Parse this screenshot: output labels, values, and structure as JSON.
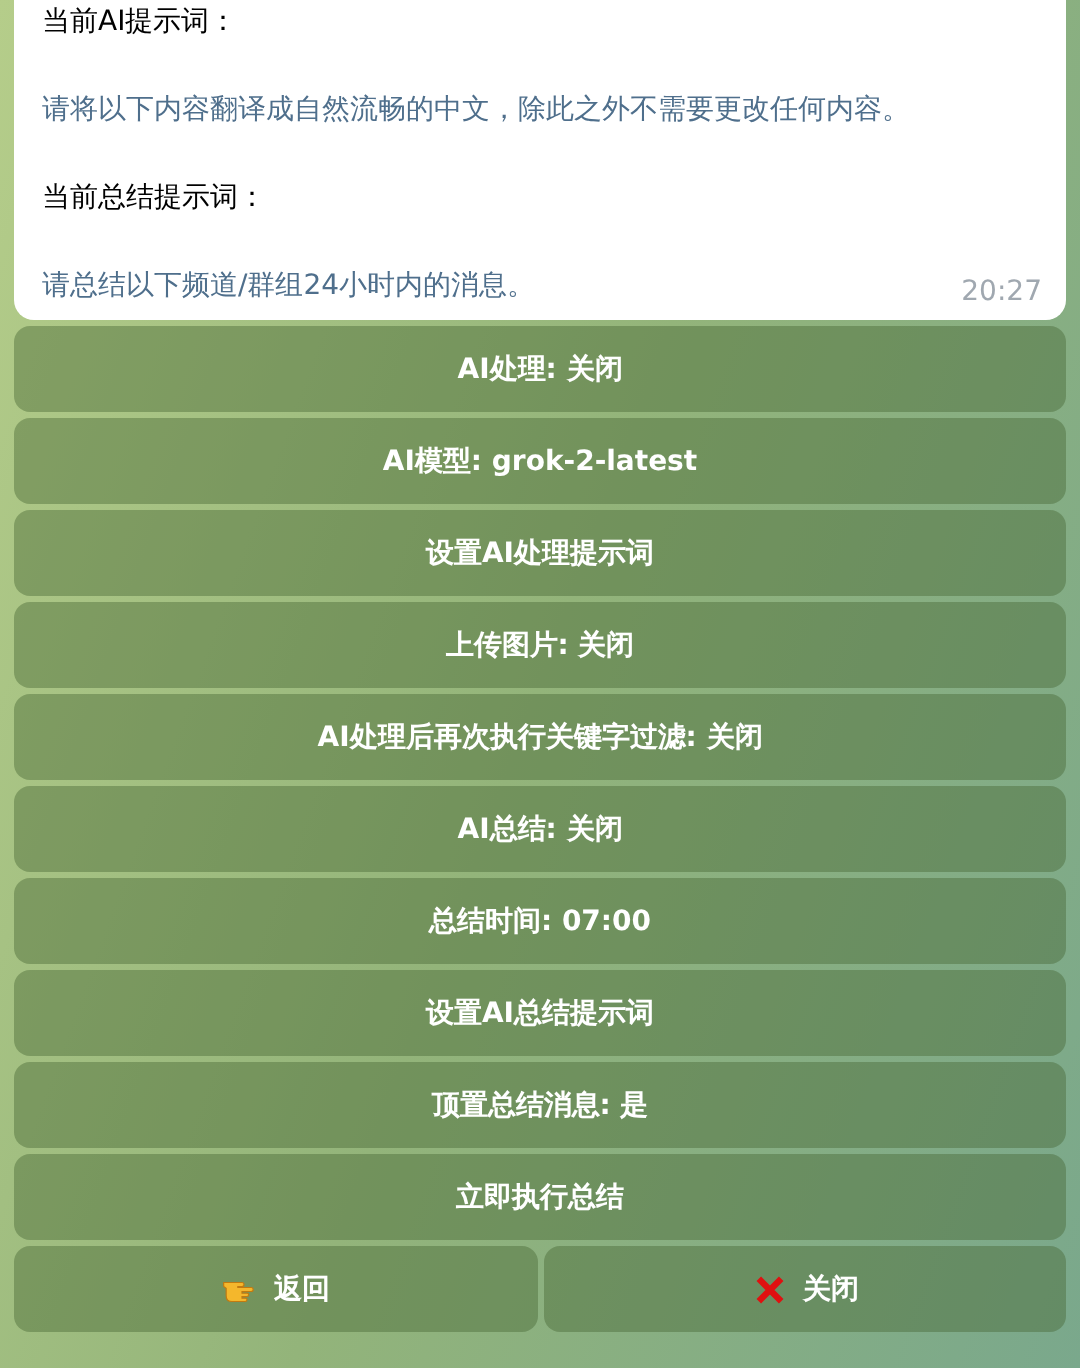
{
  "message": {
    "lines": [
      {
        "kind": "label",
        "text": "当前AI提示词："
      },
      {
        "kind": "value",
        "text": "请将以下内容翻译成自然流畅的中文，除此之外不需要更改任何内容。"
      },
      {
        "kind": "label",
        "text": "当前总结提示词："
      },
      {
        "kind": "value",
        "text": "请总结以下频道/群组24小时内的消息。"
      }
    ],
    "time": "20:27"
  },
  "keyboard": [
    [
      {
        "kind": "plain",
        "label": "AI处理: 关闭"
      }
    ],
    [
      {
        "kind": "plain",
        "label": "AI模型: grok-2-latest"
      }
    ],
    [
      {
        "kind": "plain",
        "label": "设置AI处理提示词"
      }
    ],
    [
      {
        "kind": "plain",
        "label": "上传图片: 关闭"
      }
    ],
    [
      {
        "kind": "plain",
        "label": "AI处理后再次执行关键字过滤: 关闭"
      }
    ],
    [
      {
        "kind": "plain",
        "label": "AI总结: 关闭"
      }
    ],
    [
      {
        "kind": "plain",
        "label": "总结时间: 07:00"
      }
    ],
    [
      {
        "kind": "plain",
        "label": "设置AI总结提示词"
      }
    ],
    [
      {
        "kind": "plain",
        "label": "顶置总结消息: 是"
      }
    ],
    [
      {
        "kind": "plain",
        "label": "立即执行总结"
      }
    ],
    [
      {
        "kind": "back",
        "label": "返回"
      },
      {
        "kind": "close",
        "label": "关闭"
      }
    ]
  ]
}
